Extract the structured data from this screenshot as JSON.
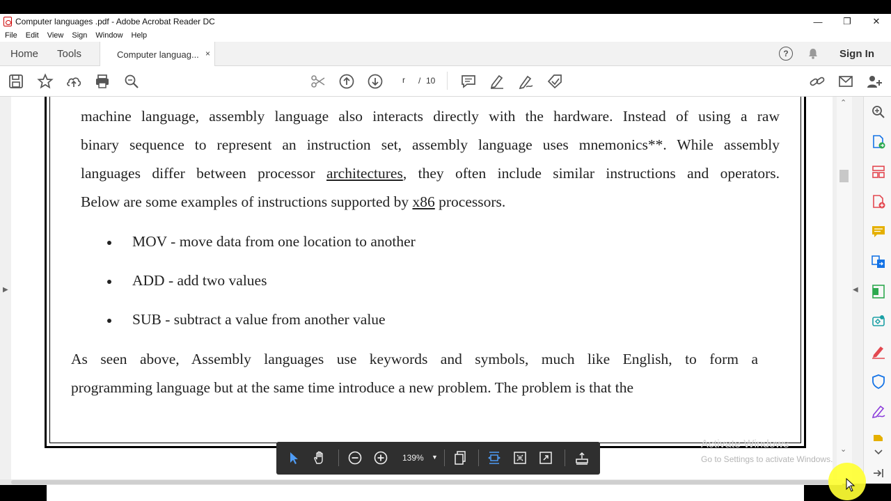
{
  "window": {
    "title": "Computer languages .pdf - Adobe Acrobat Reader DC",
    "minimize": "—",
    "restore": "❐",
    "close": "✕"
  },
  "menu": [
    "File",
    "Edit",
    "View",
    "Sign",
    "Window",
    "Help"
  ],
  "tabs": {
    "home": "Home",
    "tools": "Tools",
    "document": "Computer languag...",
    "close": "×"
  },
  "header": {
    "help": "?",
    "sign_in": "Sign In"
  },
  "toolbar": {
    "page_current": "r",
    "page_separator": "/",
    "page_total": "10"
  },
  "document": {
    "paragraph1_lines": [
      "machine language, assembly language also interacts directly with the hardware. Instead of using a raw",
      "binary sequence to represent an instruction set, assembly language uses mnemonics**. While assembly"
    ],
    "p1_line3_a": "languages differ between processor ",
    "p1_line3_link": "architectures",
    "p1_line3_b": ", they often include similar instructions and operators.",
    "p1_line4_a": "Below are some examples of instructions supported by ",
    "p1_line4_link": "x86",
    "p1_line4_b": " processors.",
    "bullets": [
      "MOV - move data from one location to another",
      "ADD - add two values",
      "SUB - subtract a value from another value"
    ],
    "paragraph2_lines": [
      "As seen above, Assembly languages use keywords and symbols, much like English, to form a",
      "programming language but at the same time introduce a new problem. The problem is that the"
    ]
  },
  "floating_toolbar": {
    "zoom": "139%"
  },
  "watermark": {
    "line1": "Activate Windows",
    "line2": "Go to Settings to activate Windows."
  },
  "colors": {
    "accent_blue": "#1473e6",
    "tool_green": "#2da94f",
    "tool_red": "#e34850",
    "tool_purple": "#8b3ddb",
    "tool_yellow": "#e5b000"
  }
}
